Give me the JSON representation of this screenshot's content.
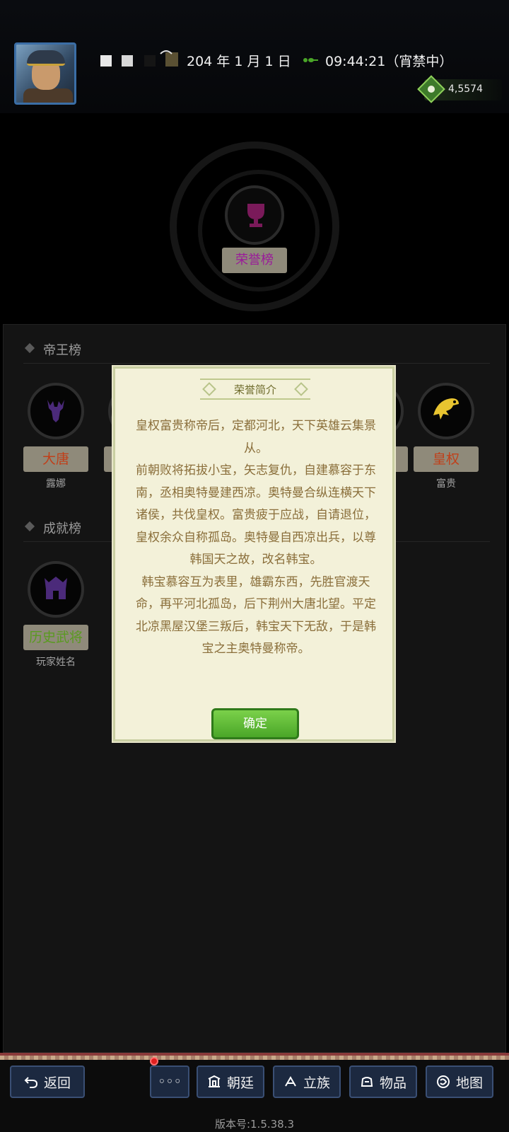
{
  "header": {
    "date": "204 年 1 月 1 日",
    "time": "09:44:21（宵禁中）",
    "currency_value": "4,5574",
    "icons": [
      "avatar",
      "status-squares",
      "umbrella-icon",
      "ant-icon",
      "money-bag-icon"
    ]
  },
  "emblem": {
    "honor_label": "荣誉榜"
  },
  "sections": {
    "emperor": {
      "title": "帝王榜",
      "slots": [
        {
          "tag": "大唐",
          "sub": "露娜",
          "icon": "deer-icon",
          "tag_color": "#c0401a"
        },
        {
          "tag": "皇权",
          "sub": "富贵",
          "icon": "eagle-icon",
          "tag_color": "#c0401a"
        }
      ]
    },
    "achievement": {
      "title": "成就榜",
      "slots": [
        {
          "tag": "历史武将",
          "sub": "玩家姓名",
          "icon": "helmet-icon",
          "tag_color": "#5a9a20"
        }
      ]
    }
  },
  "modal": {
    "title": "荣誉简介",
    "paragraphs": [
      "皇权富贵称帝后，定都河北，天下英雄云集景从。",
      "前朝败将拓拔小宝，矢志复仇，自建慕容于东南，丞相奥特曼建西凉。奥特曼合纵连横天下诸侯，共伐皇权。富贵疲于应战，自请退位，皇权余众自称孤岛。奥特曼自西凉出兵，以尊韩国天之故，改名韩宝。",
      "韩宝慕容互为表里，雄霸东西，先胜官渡天命，再平河北孤岛，后下荆州大唐北望。平定北凉黑屋汉堡三叛后，韩宝天下无敌，于是韩宝之主奥特曼称帝。"
    ],
    "confirm_label": "确定"
  },
  "bottom_nav": {
    "back": "返回",
    "more": "◦◦◦",
    "court": "朝廷",
    "clan": "立族",
    "items": "物品",
    "map": "地图"
  },
  "version": "版本号:1.5.38.3",
  "colors": {
    "accent_green": "#4aa628",
    "nav_blue": "#1c2940",
    "modal_bg": "#f3f1d9",
    "honor_purple": "#9a1a9a"
  }
}
